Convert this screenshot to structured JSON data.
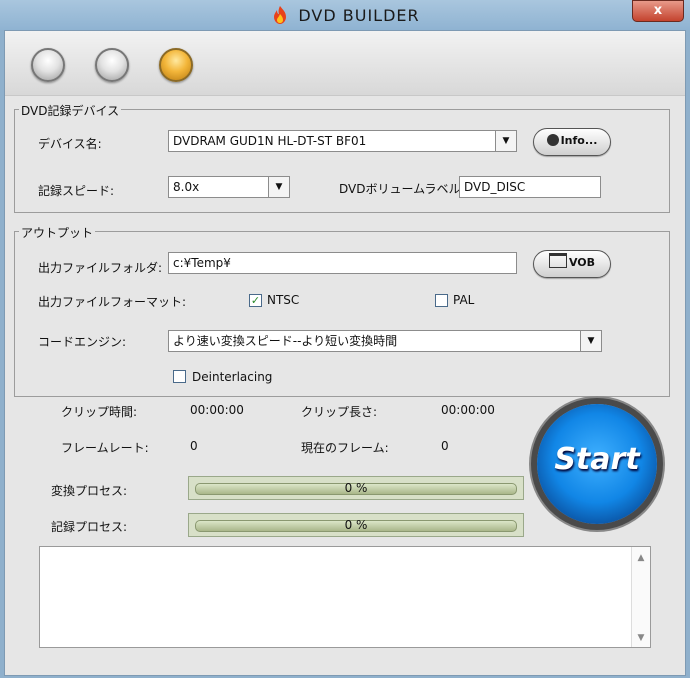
{
  "window": {
    "title": "DVD BUILDER",
    "close_label": "x"
  },
  "device_group": {
    "label": "DVD記録デバイス",
    "device_name_label": "デバイス名:",
    "device_value": "DVDRAM GUD1N    HL-DT-ST BF01",
    "info_label": "Info...",
    "speed_label": "記録スピード:",
    "speed_value": "8.0x",
    "volume_label": "DVDボリュームラベル:",
    "volume_value": "DVD_DISC"
  },
  "output_group": {
    "label": "アウトプット",
    "folder_label": "出力ファイルフォルダ:",
    "folder_value": "c:¥Temp¥",
    "vob_label": "VOB",
    "format_label": "出力ファイルフォーマット:",
    "ntsc_label": "NTSC",
    "ntsc_checked": true,
    "pal_label": "PAL",
    "pal_checked": false,
    "engine_label": "コードエンジン:",
    "engine_value": "より速い変換スピード--より短い変換時間",
    "deinterlacing_label": "Deinterlacing",
    "deinterlacing_checked": false
  },
  "status": {
    "clip_time_label": "クリップ時間:",
    "clip_time_value": "00:00:00",
    "clip_length_label": "クリップ長さ:",
    "clip_length_value": "00:00:00",
    "frame_rate_label": "フレームレート:",
    "frame_rate_value": "0",
    "current_frame_label": "現在のフレーム:",
    "current_frame_value": "0"
  },
  "progress": {
    "convert_label": "変換プロセス:",
    "convert_value": "0 %",
    "record_label": "記録プロセス:",
    "record_value": "0 %"
  },
  "start_label": "Start",
  "colors": {
    "start_blue": "#1186e6",
    "active_orb": "#f3b63a"
  }
}
